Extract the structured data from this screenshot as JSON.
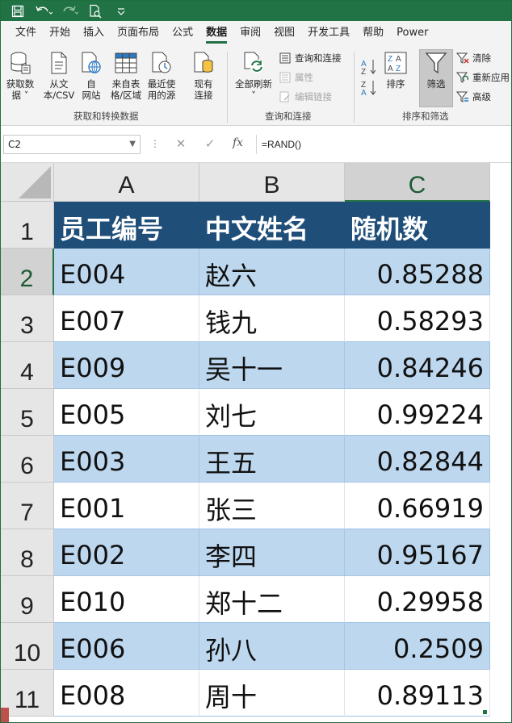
{
  "tabs": [
    "文件",
    "开始",
    "插入",
    "页面布局",
    "公式",
    "数据",
    "审阅",
    "视图",
    "开发工具",
    "帮助",
    "Power"
  ],
  "active_tab_index": 5,
  "ribbon": {
    "get_transform": {
      "buttons": [
        "获取数\n据 ˅",
        "从文\n本/CSV",
        "自\n网站",
        "来自表\n格/区域",
        "最近使\n用的源",
        "现有\n连接"
      ],
      "label": "获取和转换数据"
    },
    "queries": {
      "refresh_all": "全部刷新\n˅",
      "queries_connections": "查询和连接",
      "properties": "属性",
      "edit_links": "编辑链接",
      "label": "查询和连接"
    },
    "sort_filter": {
      "sort": "排序",
      "filter": "筛选",
      "clear": "清除",
      "reapply": "重新应用",
      "advanced": "高级",
      "label": "排序和筛选"
    }
  },
  "formula_bar": {
    "name_box": "C2",
    "formula": "=RAND()"
  },
  "columns": [
    "A",
    "B",
    "C"
  ],
  "selected_column": 2,
  "row_numbers": [
    "1",
    "2",
    "3",
    "4",
    "5",
    "6",
    "7",
    "8",
    "9",
    "10",
    "11"
  ],
  "selected_row": 1,
  "header_row": [
    "员工编号",
    "中文姓名",
    "随机数"
  ],
  "rows": [
    [
      "E004",
      "赵六",
      "0.85288"
    ],
    [
      "E007",
      "钱九",
      "0.58293"
    ],
    [
      "E009",
      "吴十一",
      "0.84246"
    ],
    [
      "E005",
      "刘七",
      "0.99224"
    ],
    [
      "E003",
      "王五",
      "0.82844"
    ],
    [
      "E001",
      "张三",
      "0.66919"
    ],
    [
      "E002",
      "李四",
      "0.95167"
    ],
    [
      "E010",
      "郑十二",
      "0.29958"
    ],
    [
      "E006",
      "孙八",
      "0.2509"
    ],
    [
      "E008",
      "周十",
      "0.89113"
    ]
  ],
  "colors": {
    "accent": "#217346",
    "table_header": "#1f4e79",
    "band": "#bdd7ee"
  }
}
